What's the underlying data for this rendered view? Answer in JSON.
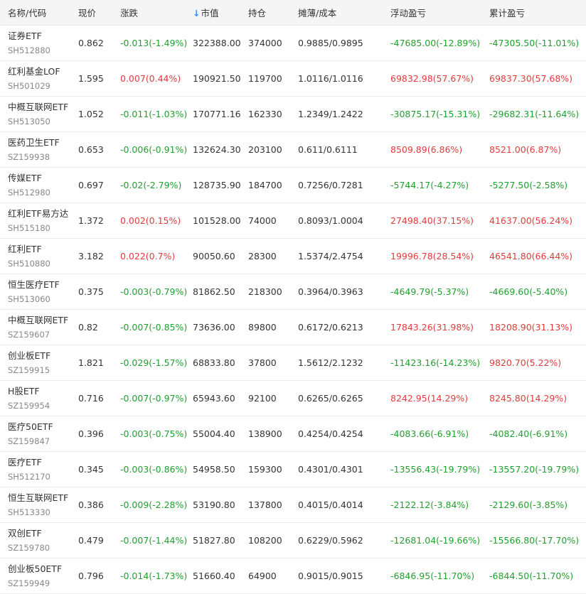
{
  "colors": {
    "up": "#e23b3b",
    "down": "#22a02f",
    "header_bg": "#f5f5f5",
    "sort_arrow": "#3f8cf0"
  },
  "columns": {
    "name": "名称/代码",
    "price": "现价",
    "change": "涨跌",
    "sort_arrow": "↓",
    "market_value": "市值",
    "position": "持仓",
    "cost": "摊薄/成本",
    "float_pnl": "浮动盈亏",
    "total_pnl": "累计盈亏"
  },
  "rows": [
    {
      "name": "证券ETF",
      "code": "SH512880",
      "price": "0.862",
      "change": "-0.013(-1.49%)",
      "change_dir": "down",
      "market_value": "322388.00",
      "position": "374000",
      "cost": "0.9885/0.9895",
      "float_pnl": "-47685.00(-12.89%)",
      "float_dir": "down",
      "total_pnl": "-47305.50(-11.01%)",
      "total_dir": "down"
    },
    {
      "name": "红利基金LOF",
      "code": "SH501029",
      "price": "1.595",
      "change": "0.007(0.44%)",
      "change_dir": "up",
      "market_value": "190921.50",
      "position": "119700",
      "cost": "1.0116/1.0116",
      "float_pnl": "69832.98(57.67%)",
      "float_dir": "up",
      "total_pnl": "69837.30(57.68%)",
      "total_dir": "up"
    },
    {
      "name": "中概互联网ETF",
      "code": "SH513050",
      "price": "1.052",
      "change": "-0.011(-1.03%)",
      "change_dir": "down",
      "market_value": "170771.16",
      "position": "162330",
      "cost": "1.2349/1.2422",
      "float_pnl": "-30875.17(-15.31%)",
      "float_dir": "down",
      "total_pnl": "-29682.31(-11.64%)",
      "total_dir": "down"
    },
    {
      "name": "医药卫生ETF",
      "code": "SZ159938",
      "price": "0.653",
      "change": "-0.006(-0.91%)",
      "change_dir": "down",
      "market_value": "132624.30",
      "position": "203100",
      "cost": "0.611/0.6111",
      "float_pnl": "8509.89(6.86%)",
      "float_dir": "up",
      "total_pnl": "8521.00(6.87%)",
      "total_dir": "up"
    },
    {
      "name": "传媒ETF",
      "code": "SH512980",
      "price": "0.697",
      "change": "-0.02(-2.79%)",
      "change_dir": "down",
      "market_value": "128735.90",
      "position": "184700",
      "cost": "0.7256/0.7281",
      "float_pnl": "-5744.17(-4.27%)",
      "float_dir": "down",
      "total_pnl": "-5277.50(-2.58%)",
      "total_dir": "down"
    },
    {
      "name": "红利ETF易方达",
      "code": "SH515180",
      "price": "1.372",
      "change": "0.002(0.15%)",
      "change_dir": "up",
      "market_value": "101528.00",
      "position": "74000",
      "cost": "0.8093/1.0004",
      "float_pnl": "27498.40(37.15%)",
      "float_dir": "up",
      "total_pnl": "41637.00(56.24%)",
      "total_dir": "up"
    },
    {
      "name": "红利ETF",
      "code": "SH510880",
      "price": "3.182",
      "change": "0.022(0.7%)",
      "change_dir": "up",
      "market_value": "90050.60",
      "position": "28300",
      "cost": "1.5374/2.4754",
      "float_pnl": "19996.78(28.54%)",
      "float_dir": "up",
      "total_pnl": "46541.80(66.44%)",
      "total_dir": "up"
    },
    {
      "name": "恒生医疗ETF",
      "code": "SH513060",
      "price": "0.375",
      "change": "-0.003(-0.79%)",
      "change_dir": "down",
      "market_value": "81862.50",
      "position": "218300",
      "cost": "0.3964/0.3963",
      "float_pnl": "-4649.79(-5.37%)",
      "float_dir": "down",
      "total_pnl": "-4669.60(-5.40%)",
      "total_dir": "down"
    },
    {
      "name": "中概互联网ETF",
      "code": "SZ159607",
      "price": "0.82",
      "change": "-0.007(-0.85%)",
      "change_dir": "down",
      "market_value": "73636.00",
      "position": "89800",
      "cost": "0.6172/0.6213",
      "float_pnl": "17843.26(31.98%)",
      "float_dir": "up",
      "total_pnl": "18208.90(31.13%)",
      "total_dir": "up"
    },
    {
      "name": "创业板ETF",
      "code": "SZ159915",
      "price": "1.821",
      "change": "-0.029(-1.57%)",
      "change_dir": "down",
      "market_value": "68833.80",
      "position": "37800",
      "cost": "1.5612/2.1232",
      "float_pnl": "-11423.16(-14.23%)",
      "float_dir": "down",
      "total_pnl": "9820.70(5.22%)",
      "total_dir": "up"
    },
    {
      "name": "H股ETF",
      "code": "SZ159954",
      "price": "0.716",
      "change": "-0.007(-0.97%)",
      "change_dir": "down",
      "market_value": "65943.60",
      "position": "92100",
      "cost": "0.6265/0.6265",
      "float_pnl": "8242.95(14.29%)",
      "float_dir": "up",
      "total_pnl": "8245.80(14.29%)",
      "total_dir": "up"
    },
    {
      "name": "医疗50ETF",
      "code": "SZ159847",
      "price": "0.396",
      "change": "-0.003(-0.75%)",
      "change_dir": "down",
      "market_value": "55004.40",
      "position": "138900",
      "cost": "0.4254/0.4254",
      "float_pnl": "-4083.66(-6.91%)",
      "float_dir": "down",
      "total_pnl": "-4082.40(-6.91%)",
      "total_dir": "down"
    },
    {
      "name": "医疗ETF",
      "code": "SH512170",
      "price": "0.345",
      "change": "-0.003(-0.86%)",
      "change_dir": "down",
      "market_value": "54958.50",
      "position": "159300",
      "cost": "0.4301/0.4301",
      "float_pnl": "-13556.43(-19.79%)",
      "float_dir": "down",
      "total_pnl": "-13557.20(-19.79%)",
      "total_dir": "down"
    },
    {
      "name": "恒生互联网ETF",
      "code": "SH513330",
      "price": "0.386",
      "change": "-0.009(-2.28%)",
      "change_dir": "down",
      "market_value": "53190.80",
      "position": "137800",
      "cost": "0.4015/0.4014",
      "float_pnl": "-2122.12(-3.84%)",
      "float_dir": "down",
      "total_pnl": "-2129.60(-3.85%)",
      "total_dir": "down"
    },
    {
      "name": "双创ETF",
      "code": "SZ159780",
      "price": "0.479",
      "change": "-0.007(-1.44%)",
      "change_dir": "down",
      "market_value": "51827.80",
      "position": "108200",
      "cost": "0.6229/0.5962",
      "float_pnl": "-12681.04(-19.66%)",
      "float_dir": "down",
      "total_pnl": "-15566.80(-17.70%)",
      "total_dir": "down"
    },
    {
      "name": "创业板50ETF",
      "code": "SZ159949",
      "price": "0.796",
      "change": "-0.014(-1.73%)",
      "change_dir": "down",
      "market_value": "51660.40",
      "position": "64900",
      "cost": "0.9015/0.9015",
      "float_pnl": "-6846.95(-11.70%)",
      "float_dir": "down",
      "total_pnl": "-6844.50(-11.70%)",
      "total_dir": "down"
    }
  ]
}
